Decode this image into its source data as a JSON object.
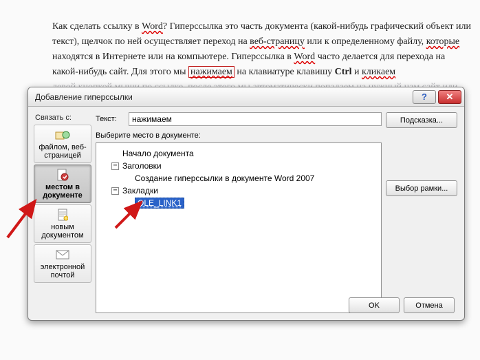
{
  "document": {
    "p1_pre": "Как сделать ссылку в ",
    "p1_word": "Word",
    "p1_q": "? Гиперссылка это часть документа (какой-нибудь графический объект или текст), щелчок по ней осуществляет переход на ",
    "p1_web": "веб-страницу",
    "p1_or": " или к определенному файлу, ",
    "p1_which": "которые",
    "p1_mid": " находятся в Интернете или на компьютере. Гиперссылка в ",
    "p1_word2": "Word",
    "p1_after": " часто делается  для перехода на какой-нибудь сайт. Для этого мы ",
    "p1_press": "нажимаем",
    "p1_tail": " на клавиатуре клавишу ",
    "p1_ctrl": "Ctrl",
    "p1_and": " и ",
    "p1_click": "кликаем",
    "p1_last": "левой кнопкой мыши по ссылке, после этого мы автоматически попадаем на нужный нам сайт или"
  },
  "dialog": {
    "title": "Добавление гиперссылки",
    "link_with": "Связать с:",
    "text_label": "Текст:",
    "text_value": "нажимаем",
    "hint_btn": "Подсказка...",
    "select_label": "Выберите место в документе:",
    "frame_btn": "Выбор рамки...",
    "side": {
      "file": "файлом, веб-страницей",
      "place": "местом в документе",
      "newdoc": "новым документом",
      "email": "электронной почтой"
    },
    "tree": {
      "doc_start": "Начало документа",
      "headings": "Заголовки",
      "heading_item": "Создание гиперссылки в документе Word 2007",
      "bookmarks": "Закладки",
      "bookmark_item": "OLE_LINK1"
    },
    "ok": "OK",
    "cancel": "Отмена"
  }
}
